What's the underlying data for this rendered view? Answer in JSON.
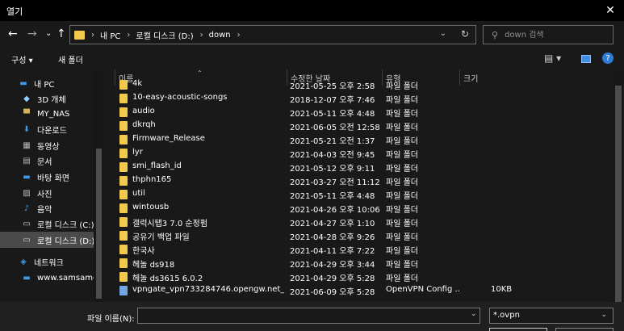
{
  "window": {
    "title": "열기",
    "close_glyph": "✕"
  },
  "navigation": {
    "back_glyph": "←",
    "forward_glyph": "→",
    "recent_glyph": "⌄",
    "up_glyph": "↑",
    "breadcrumb": [
      "내 PC",
      "로컬 디스크 (D:)",
      "down"
    ],
    "breadcrumb_separator": "›",
    "dropdown_glyph": "⌄",
    "refresh_glyph": "↻",
    "search_placeholder": "down 검색",
    "search_icon": "⚲"
  },
  "toolbar": {
    "organize_label": "구성 ▾",
    "new_folder_label": "새 폴더",
    "view_glyph": "▤ ▾",
    "help_glyph": "?"
  },
  "sidebar": {
    "items": [
      {
        "label": "내 PC",
        "icon": "pc-icon",
        "glyph": "▬",
        "color": "#3f9ae8"
      },
      {
        "label": "3D 개체",
        "icon": "3d-objects-icon",
        "glyph": "◆",
        "color": "#8fd0ff"
      },
      {
        "label": "MY_NAS",
        "icon": "nas-icon",
        "glyph": "▀",
        "color": "#d7b45a"
      },
      {
        "label": "다운로드",
        "icon": "download-icon",
        "glyph": "⬇",
        "color": "#3f9ae8"
      },
      {
        "label": "동영상",
        "icon": "video-icon",
        "glyph": "▦",
        "color": "#bbbbbb"
      },
      {
        "label": "문서",
        "icon": "document-icon",
        "glyph": "▤",
        "color": "#bbbbbb"
      },
      {
        "label": "바탕 화면",
        "icon": "desktop-icon",
        "glyph": "▬",
        "color": "#3f9ae8"
      },
      {
        "label": "사진",
        "icon": "pictures-icon",
        "glyph": "▨",
        "color": "#bbbbbb"
      },
      {
        "label": "음악",
        "icon": "music-icon",
        "glyph": "♪",
        "color": "#3f9ae8"
      },
      {
        "label": "로컬 디스크 (C:)",
        "icon": "drive-c-icon",
        "glyph": "▭",
        "color": "#cfcfcf"
      },
      {
        "label": "로컬 디스크 (D:)",
        "icon": "drive-d-icon",
        "glyph": "▭",
        "color": "#cfcfcf"
      },
      {
        "label": "네트워크",
        "icon": "network-icon",
        "glyph": "◈",
        "color": "#3f9ae8"
      },
      {
        "label": "www.samsamen",
        "icon": "network-pc-icon",
        "glyph": "▬",
        "color": "#3f9ae8"
      }
    ]
  },
  "file_list": {
    "sort_glyph": "⌃",
    "columns": [
      "이름",
      "수정한 날짜",
      "유형",
      "크기"
    ],
    "rows": [
      {
        "name": "4k",
        "date": "2021-05-25 오후 2:58",
        "type": "파일 폴더",
        "size": "",
        "kind": "folder"
      },
      {
        "name": "10-easy-acoustic-songs",
        "date": "2018-12-07 오후 7:46",
        "type": "파일 폴더",
        "size": "",
        "kind": "folder"
      },
      {
        "name": "audio",
        "date": "2021-05-11 오후 4:48",
        "type": "파일 폴더",
        "size": "",
        "kind": "folder"
      },
      {
        "name": "dkrqh",
        "date": "2021-06-05 오전 12:58",
        "type": "파일 폴더",
        "size": "",
        "kind": "folder"
      },
      {
        "name": "Firmware_Release",
        "date": "2021-05-21 오전 1:37",
        "type": "파일 폴더",
        "size": "",
        "kind": "folder"
      },
      {
        "name": "lyr",
        "date": "2021-04-03 오전 9:45",
        "type": "파일 폴더",
        "size": "",
        "kind": "folder"
      },
      {
        "name": "smi_flash_id",
        "date": "2021-05-12 오후 9:11",
        "type": "파일 폴더",
        "size": "",
        "kind": "folder"
      },
      {
        "name": "thphn165",
        "date": "2021-03-27 오전 11:12",
        "type": "파일 폴더",
        "size": "",
        "kind": "folder"
      },
      {
        "name": "util",
        "date": "2021-05-11 오후 4:48",
        "type": "파일 폴더",
        "size": "",
        "kind": "folder"
      },
      {
        "name": "wintousb",
        "date": "2021-04-26 오후 10:06",
        "type": "파일 폴더",
        "size": "",
        "kind": "folder"
      },
      {
        "name": "갤럭시탭3 7.0 순정펌",
        "date": "2021-04-27 오후 1:10",
        "type": "파일 폴더",
        "size": "",
        "kind": "folder"
      },
      {
        "name": "공유기 백업 파일",
        "date": "2021-04-28 오후 9:26",
        "type": "파일 폴더",
        "size": "",
        "kind": "folder"
      },
      {
        "name": "한국사",
        "date": "2021-04-11 오후 7:22",
        "type": "파일 폴더",
        "size": "",
        "kind": "folder"
      },
      {
        "name": "헤놀 ds918",
        "date": "2021-04-29 오후 3:44",
        "type": "파일 폴더",
        "size": "",
        "kind": "folder"
      },
      {
        "name": "헤놀 ds3615 6.0.2",
        "date": "2021-04-29 오후 5:28",
        "type": "파일 폴더",
        "size": "",
        "kind": "folder"
      },
      {
        "name": "vpngate_vpn733284746.opengw.net_ud...",
        "date": "2021-06-09 오후 5:28",
        "type": "OpenVPN Config ...",
        "size": "10KB",
        "kind": "file"
      }
    ]
  },
  "bottom_bar": {
    "filename_label": "파일 이름(N):",
    "filename_value": "",
    "filter_value": "*.ovpn",
    "dropdown_glyph": "⌄"
  }
}
